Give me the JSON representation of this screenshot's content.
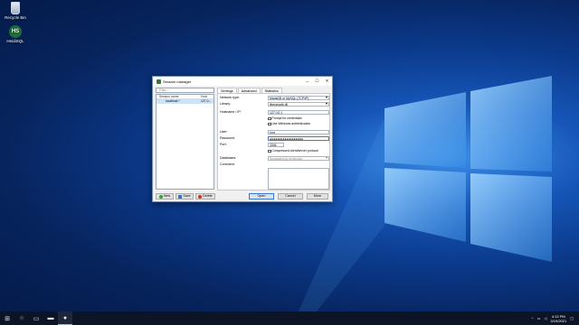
{
  "desktop": {
    "icons": [
      {
        "label": "Recycle Bin",
        "icon": "recycle-bin-icon"
      },
      {
        "label": "HeidiSQL",
        "icon": "heidisql-icon",
        "glyph": "HS"
      }
    ]
  },
  "dialog": {
    "title": "Session manager",
    "controls": {
      "minimize": "─",
      "maximize": "☐",
      "close": "✕"
    },
    "filter_placeholder": "Filter...",
    "tree": {
      "headers": [
        "Session name",
        "Host"
      ],
      "rows": [
        {
          "name": "localhost *",
          "host": "127.0..."
        }
      ]
    },
    "tabs": [
      "Settings",
      "Advanced",
      "Statistics"
    ],
    "settings": {
      "network_type_label": "Network type:",
      "network_type_value": "MariaDB or MySQL (TCP/IP)",
      "library_label": "Library:",
      "library_value": "libmariadb.dll",
      "hostname_label": "Hostname / IP:",
      "hostname_value": "127.0.0.1",
      "prompt_label": "Prompt for credentials",
      "windows_auth_label": "Use Windows authentication",
      "user_label": "User:",
      "user_value": "root",
      "password_label": "Password:",
      "password_value": "●●●●●●●●●●●●●●●●●●",
      "port_label": "Port:",
      "port_value": "3306",
      "compressed_label": "Compressed client/server protocol",
      "databases_label": "Databases:",
      "databases_placeholder": "Separated by semicolon",
      "comment_label": "Comment:"
    },
    "buttons": {
      "new": "New",
      "save": "Save",
      "delete": "Delete",
      "open": "Open",
      "cancel": "Cancel",
      "more": "More"
    }
  },
  "taskbar": {
    "items": [
      "start-icon",
      "search-icon",
      "task-view-icon",
      "explorer-icon",
      "heidisql-icon"
    ],
    "time": "4:13 PM",
    "date": "3/19/2021"
  }
}
